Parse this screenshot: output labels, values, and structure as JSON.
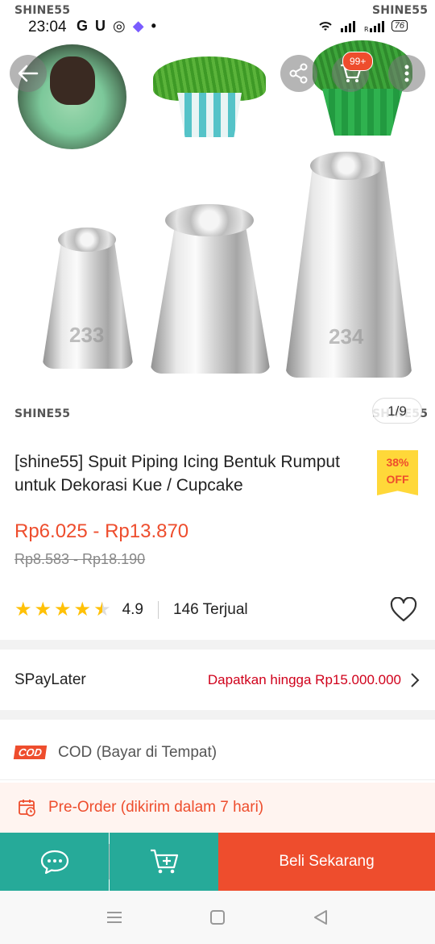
{
  "status_bar": {
    "time": "23:04",
    "icons": [
      "G",
      "U",
      "◎",
      "◆",
      "•"
    ],
    "battery": "76"
  },
  "hero": {
    "watermark": "SHINE55",
    "image_counter": "1/9",
    "cart_badge": "99+",
    "tip_numbers": [
      "233",
      "234"
    ]
  },
  "product": {
    "title": "[shine55] Spuit Piping Icing Bentuk Rumput untuk Dekorasi Kue / Cupcake",
    "discount_pct": "38%",
    "discount_off": "OFF",
    "price": "Rp6.025 - Rp13.870",
    "old_price": "Rp8.583 - Rp18.190",
    "rating": "4.9",
    "sold": "146 Terjual"
  },
  "spaylater": {
    "label": "SPayLater",
    "promo": "Dapatkan hingga Rp15.000.000"
  },
  "cod": {
    "logo": "COD",
    "label": "COD (Bayar di Tempat)"
  },
  "preorder": {
    "label": "Pre-Order (dikirim dalam 7 hari)"
  },
  "actions": {
    "buy_label": "Beli Sekarang"
  },
  "colors": {
    "brand": "#ee4d2d",
    "teal": "#26aa99",
    "star": "#ffc107",
    "discount_badge": "#ffd839"
  }
}
